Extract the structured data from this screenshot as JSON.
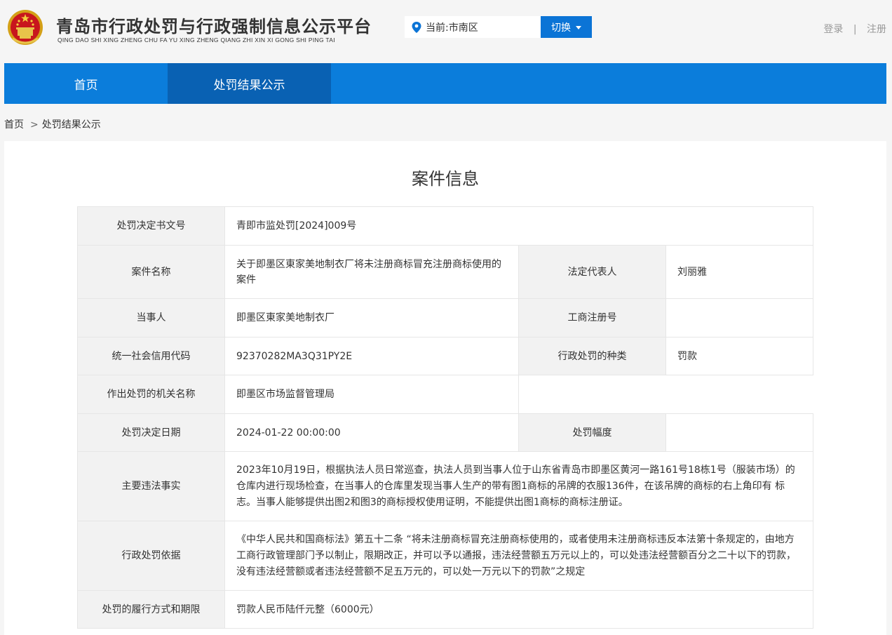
{
  "header": {
    "title": "青岛市行政处罚与行政强制信息公示平台",
    "subtitle": "QING DAO SHI XING ZHENG CHU FA YU XING ZHENG QIANG ZHI XIN XI GONG SHI PING TAI",
    "location_text": "当前:市南区",
    "switch_label": "切换",
    "login": "登录",
    "separator": "|",
    "register": "注册"
  },
  "nav": {
    "items": [
      {
        "label": "首页"
      },
      {
        "label": "处罚结果公示"
      }
    ]
  },
  "breadcrumb": {
    "home": "首页",
    "separator": ">",
    "current": "处罚结果公示"
  },
  "card": {
    "title": "案件信息"
  },
  "case": {
    "doc_no_label": "处罚决定书文号",
    "doc_no": "青即市监处罚[2024]009号",
    "case_name_label": "案件名称",
    "case_name": "关于即墨区東家美地制衣厂将未注册商标冒充注册商标使用的案件",
    "legal_rep_label": "法定代表人",
    "legal_rep": "刘丽雅",
    "party_label": "当事人",
    "party": "即墨区東家美地制衣厂",
    "reg_no_label": "工商注册号",
    "reg_no": "",
    "credit_code_label": "统一社会信用代码",
    "credit_code": "92370282MA3Q31PY2E",
    "penalty_type_label": "行政处罚的种类",
    "penalty_type": "罚款",
    "authority_label": "作出处罚的机关名称",
    "authority": "即墨区市场监督管理局",
    "decision_date_label": "处罚决定日期",
    "decision_date": "2024-01-22 00:00:00",
    "penalty_range_label": "处罚幅度",
    "penalty_range": "",
    "facts_label": "主要违法事实",
    "facts": "2023年10月19日，根据执法人员日常巡查，执法人员到当事人位于山东省青岛市即墨区黄河一路161号18栋1号（服装市场）的仓库内进行现场检查，在当事人的仓库里发现当事人生产的带有图1商标的吊牌的衣服136件，在该吊牌的商标的右上角印有 标志。当事人能够提供出图2和图3的商标授权使用证明，不能提供出图1商标的商标注册证。",
    "basis_label": "行政处罚依据",
    "basis": "《中华人民共和国商标法》第五十二条 “将未注册商标冒充注册商标使用的，或者使用未注册商标违反本法第十条规定的，由地方工商行政管理部门予以制止，限期改正，并可以予以通报，违法经营额五万元以上的，可以处违法经营额百分之二十以下的罚款，没有违法经营额或者违法经营额不足五万元的，可以处一万元以下的罚款”之规定",
    "execution_label": "处罚的履行方式和期限",
    "execution": "罚款人民币陆仟元整（6000元）"
  },
  "colors": {
    "nav_blue": "#0b7ddb",
    "nav_active": "#0961b3",
    "button_blue": "#0b74d6",
    "label_bg": "#f2f2f2"
  }
}
